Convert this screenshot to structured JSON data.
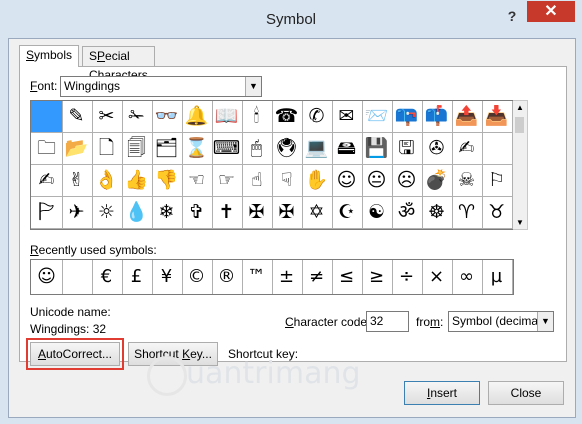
{
  "dialog": {
    "title": "Symbol",
    "help_glyph": "?",
    "close_glyph": "✕"
  },
  "tabs": [
    {
      "label": "Symbols",
      "accel": "S",
      "rest": "ymbols",
      "active": true
    },
    {
      "label": "Special Characters",
      "accel": "P",
      "pre": "S",
      "rest": "ecial Characters",
      "active": false
    }
  ],
  "font": {
    "label_accel": "F",
    "label_rest": "ont:",
    "value": "Wingdings"
  },
  "symbol_grid": [
    [
      "",
      "✎",
      "✂",
      "✁",
      "👓",
      "🔔",
      "📖",
      "🕯",
      "☎",
      "✆",
      "✉",
      "📨",
      "📪",
      "📫",
      "📤",
      "📥"
    ],
    [
      "🗀",
      "📂",
      "🗋",
      "🗐",
      "🗂",
      "⌛",
      "⌨",
      "🖱",
      "🖲",
      "💻",
      "🖴",
      "💾",
      "🖫",
      "✇",
      "✍",
      ""
    ],
    [
      "✍",
      "✌",
      "👌",
      "👍",
      "👎",
      "☜",
      "☞",
      "☝",
      "☟",
      "✋",
      "☺",
      "😐",
      "☹",
      "💣",
      "☠",
      "⚐"
    ],
    [
      "🏱",
      "✈",
      "☼",
      "💧",
      "❄",
      "✞",
      "✝",
      "✠",
      "✠",
      "✡",
      "☪",
      "☯",
      "ॐ",
      "☸",
      "♈",
      "♉"
    ]
  ],
  "recent": {
    "label_accel": "R",
    "label_rest": "ecently used symbols:",
    "symbols": [
      "☺",
      "",
      "€",
      "£",
      "¥",
      "©",
      "®",
      "™",
      "±",
      "≠",
      "≤",
      "≥",
      "÷",
      "×",
      "∞",
      "µ"
    ]
  },
  "info": {
    "unicode_name_label": "Unicode name:",
    "char_name": "Wingdings: 32",
    "char_code_label_accel": "C",
    "char_code_label_rest": "haracter code:",
    "char_code_value": "32",
    "from_label_accel": "m",
    "from_label_pre": "fro",
    "from_label_post": ":",
    "from_value": "Symbol (decimal)",
    "shortcut_key_label": "Shortcut key:"
  },
  "buttons": {
    "autocorrect_accel": "A",
    "autocorrect_rest": "utoCorrect...",
    "shortcut_pre": "Shortcut ",
    "shortcut_accel": "K",
    "shortcut_rest": "ey...",
    "insert_accel": "I",
    "insert_rest": "nsert",
    "close": "Close"
  },
  "watermark": "uantrimang"
}
